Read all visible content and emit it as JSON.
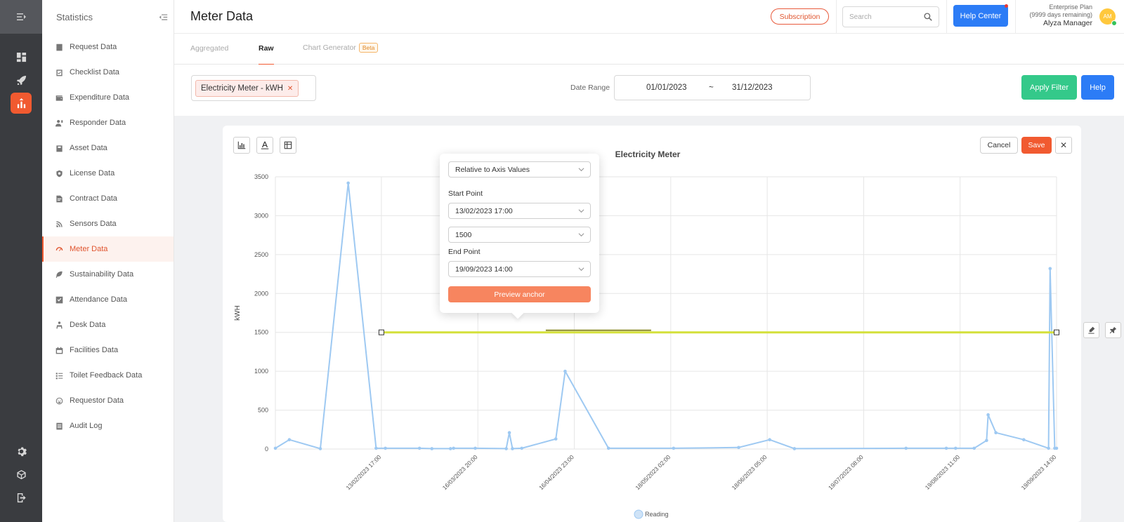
{
  "sidebar": {
    "title": "Statistics",
    "items": [
      {
        "label": "Request Data",
        "icon": "request-icon"
      },
      {
        "label": "Checklist Data",
        "icon": "checklist-icon"
      },
      {
        "label": "Expenditure Data",
        "icon": "wallet-icon"
      },
      {
        "label": "Responder Data",
        "icon": "responder-icon"
      },
      {
        "label": "Asset Data",
        "icon": "asset-icon"
      },
      {
        "label": "License Data",
        "icon": "shield-icon"
      },
      {
        "label": "Contract Data",
        "icon": "contract-icon"
      },
      {
        "label": "Sensors Data",
        "icon": "wifi-icon"
      },
      {
        "label": "Meter Data",
        "icon": "gauge-icon",
        "active": true
      },
      {
        "label": "Sustainability Data",
        "icon": "leaf-icon"
      },
      {
        "label": "Attendance Data",
        "icon": "check-square-icon"
      },
      {
        "label": "Desk Data",
        "icon": "desk-icon"
      },
      {
        "label": "Facilities Data",
        "icon": "calendar-icon"
      },
      {
        "label": "Toilet Feedback Data",
        "icon": "list-icon"
      },
      {
        "label": "Requestor Data",
        "icon": "smile-icon"
      },
      {
        "label": "Audit Log",
        "icon": "document-icon"
      }
    ]
  },
  "header": {
    "title": "Meter Data",
    "subscription": "Subscription",
    "search_placeholder": "Search",
    "help_center": "Help Center",
    "plan": "Enterprise Plan",
    "plan_remaining": "(9999 days remaining)",
    "user_name": "Alyza Manager",
    "avatar_initials": "AM"
  },
  "tabs": [
    {
      "label": "Aggregated"
    },
    {
      "label": "Raw",
      "active": true
    },
    {
      "label": "Chart Generator",
      "badge": "Beta"
    }
  ],
  "filter": {
    "meter_chip": "Electricity Meter - kWH",
    "date_label": "Date Range",
    "date_start": "01/01/2023",
    "date_sep": "~",
    "date_end": "31/12/2023",
    "apply": "Apply Filter",
    "help": "Help"
  },
  "card": {
    "cancel": "Cancel",
    "save": "Save"
  },
  "popover": {
    "mode": "Relative to Axis Values",
    "start_label": "Start Point",
    "start_value": "13/02/2023 17:00",
    "y_value": "1500",
    "end_label": "End Point",
    "end_value": "19/09/2023 14:00",
    "preview": "Preview anchor"
  },
  "colors": {
    "accent": "#f15a30",
    "series": "#9ec9f2",
    "anchor_line": "#d4e03a"
  },
  "chart_data": {
    "type": "line",
    "title": "Electricity Meter",
    "ylabel": "kWH",
    "xlabel": "",
    "ylim": [
      0,
      3500
    ],
    "yticks": [
      0,
      500,
      1000,
      1500,
      2000,
      2500,
      3000,
      3500
    ],
    "xlim": [
      "2023-01-10 12:00",
      "2023-09-19 14:00"
    ],
    "xticks": [
      "13/02/2023 17:00",
      "16/03/2023 20:00",
      "16/04/2023 23:00",
      "18/05/2023 02:00",
      "18/06/2023 05:00",
      "19/07/2023 08:00",
      "19/08/2023 11:00",
      "19/09/2023 14:00"
    ],
    "legend": "bottom",
    "grid": true,
    "series": [
      {
        "name": "Reading",
        "points": [
          [
            "2023-01-10 12:00",
            10
          ],
          [
            "2023-01-15 00:00",
            120
          ],
          [
            "2023-01-25 00:00",
            5
          ],
          [
            "2023-02-03 00:00",
            3420
          ],
          [
            "2023-02-12 00:00",
            10
          ],
          [
            "2023-02-15 00:00",
            10
          ],
          [
            "2023-02-26 00:00",
            10
          ],
          [
            "2023-03-02 00:00",
            5
          ],
          [
            "2023-03-08 00:00",
            5
          ],
          [
            "2023-03-09 00:00",
            10
          ],
          [
            "2023-03-16 00:00",
            10
          ],
          [
            "2023-03-26 00:00",
            5
          ],
          [
            "2023-03-27 00:00",
            210
          ],
          [
            "2023-03-28 00:00",
            5
          ],
          [
            "2023-03-31 00:00",
            10
          ],
          [
            "2023-04-11 00:00",
            130
          ],
          [
            "2023-04-14 00:00",
            1000
          ],
          [
            "2023-04-28 00:00",
            10
          ],
          [
            "2023-05-19 00:00",
            10
          ],
          [
            "2023-06-09 00:00",
            20
          ],
          [
            "2023-06-19 00:00",
            120
          ],
          [
            "2023-06-27 00:00",
            5
          ],
          [
            "2023-08-02 00:00",
            10
          ],
          [
            "2023-08-15 00:00",
            10
          ],
          [
            "2023-08-18 00:00",
            10
          ],
          [
            "2023-08-24 00:00",
            10
          ],
          [
            "2023-08-28 00:00",
            110
          ],
          [
            "2023-08-28 12:00",
            440
          ],
          [
            "2023-08-31 00:00",
            210
          ],
          [
            "2023-09-09 00:00",
            120
          ],
          [
            "2023-09-17 00:00",
            10
          ],
          [
            "2023-09-17 12:00",
            2320
          ],
          [
            "2023-09-19 00:00",
            10
          ],
          [
            "2023-09-19 14:00",
            10
          ]
        ]
      }
    ],
    "annotations": [
      {
        "type": "horizontal-line",
        "y": 1500,
        "x_start": "13/02/2023 17:00",
        "x_end": "19/09/2023 14:00"
      }
    ]
  }
}
